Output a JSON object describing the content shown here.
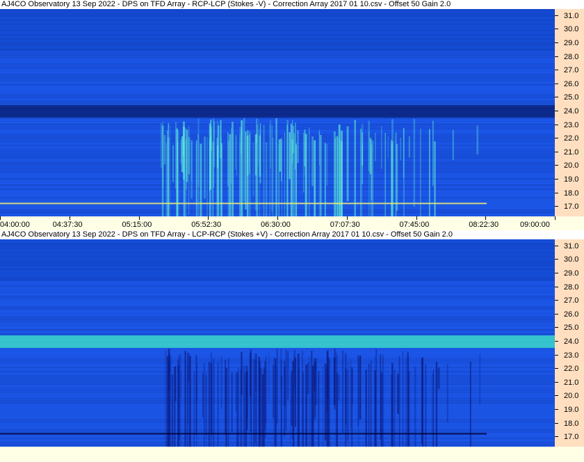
{
  "panels": [
    {
      "title": "AJ4CO Observatory 13 Sep 2022  -  DPS on TFD Array  -  RCP-LCP (Stokes -V)  -  Correction Array 2017 01 10.csv  -  Offset 50  Gain 2.0",
      "band_color": "#0a1e70",
      "burst_color": "#60f0d8",
      "bg_color": "#1a52e0"
    },
    {
      "title": "AJ4CO Observatory 13 Sep 2022  -  DPS on TFD Array  -  LCP-RCP (Stokes +V)  -  Correction Array 2017 01 10.csv  -  Offset 50  Gain 2.0",
      "band_color": "#40e8c8",
      "burst_color": "#0a1a80",
      "bg_color": "#1a52e0"
    }
  ],
  "frequency_labels": [
    "31.0",
    "30.0",
    "29.0",
    "28.0",
    "27.0",
    "26.0",
    "25.0",
    "24.0",
    "23.0",
    "22.0",
    "21.0",
    "20.0",
    "19.0",
    "18.0",
    "17.0"
  ],
  "time_labels": [
    "04:00:00",
    "04:37:30",
    "05:15:00",
    "05:52:30",
    "06:30:00",
    "07:07:30",
    "07:45:00",
    "08:22:30",
    "09:00:00"
  ],
  "colors": {
    "axis_bg": "#ffdfc0",
    "time_axis_bg": "#ffffe6"
  }
}
